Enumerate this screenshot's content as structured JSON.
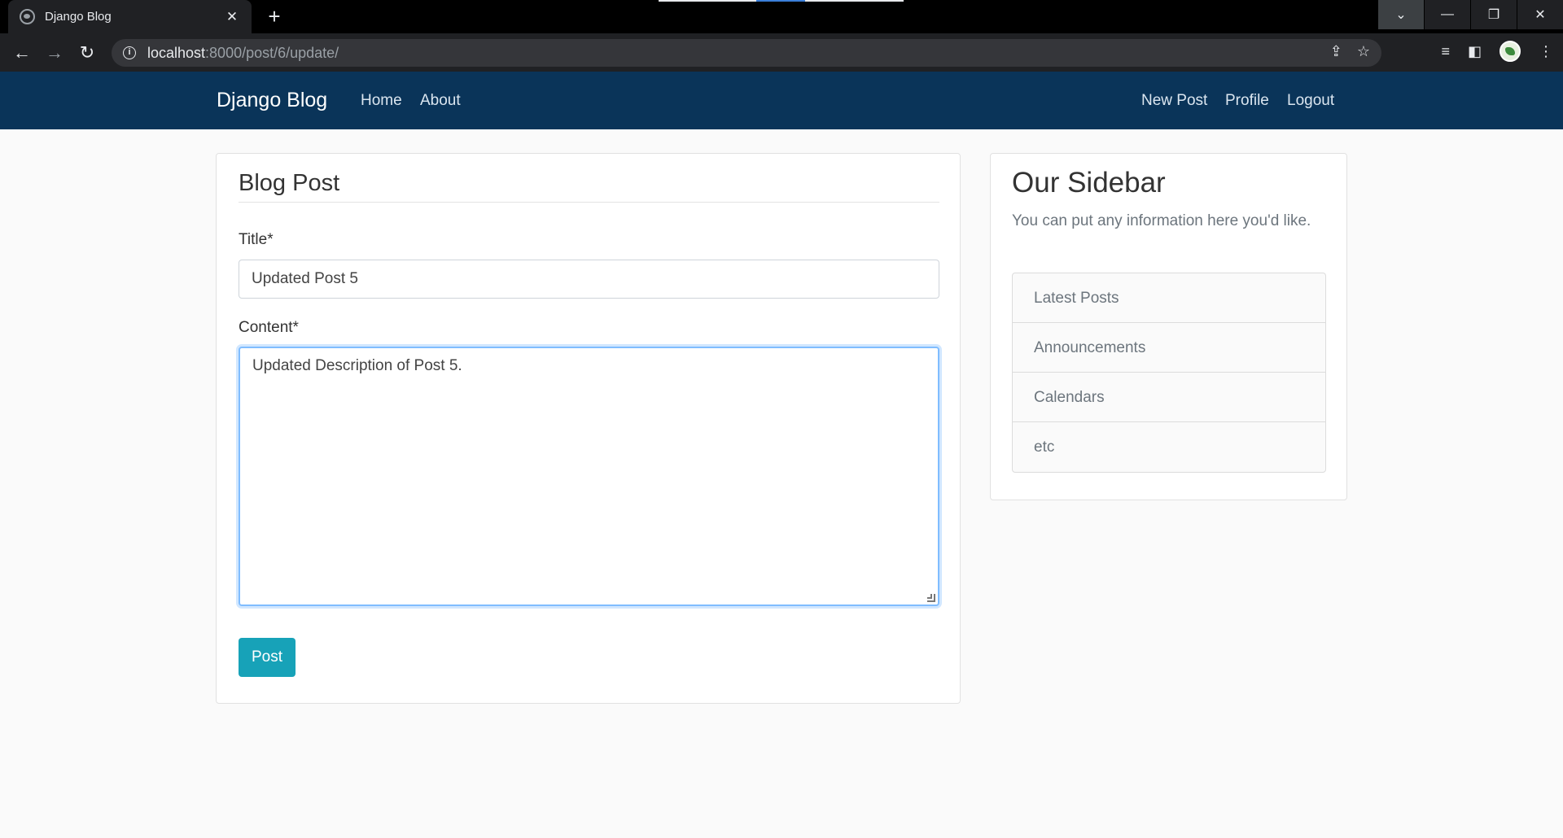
{
  "browser": {
    "tab_title": "Django Blog",
    "new_tab_symbol": "+",
    "url_host": "localhost",
    "url_path": ":8000/post/6/update/"
  },
  "site": {
    "brand": "Django Blog",
    "nav_left": [
      "Home",
      "About"
    ],
    "nav_right": [
      "New Post",
      "Profile",
      "Logout"
    ]
  },
  "form": {
    "legend": "Blog Post",
    "title_label": "Title*",
    "title_value": "Updated Post 5",
    "content_label": "Content*",
    "content_value": "Updated Description of Post 5.",
    "submit_label": "Post"
  },
  "sidebar": {
    "title": "Our Sidebar",
    "text": "You can put any information here you'd like.",
    "items": [
      "Latest Posts",
      "Announcements",
      "Calendars",
      "etc"
    ]
  },
  "colors": {
    "navbar": "#0a3459",
    "button": "#17a2b8",
    "focus": "#80bdff"
  }
}
